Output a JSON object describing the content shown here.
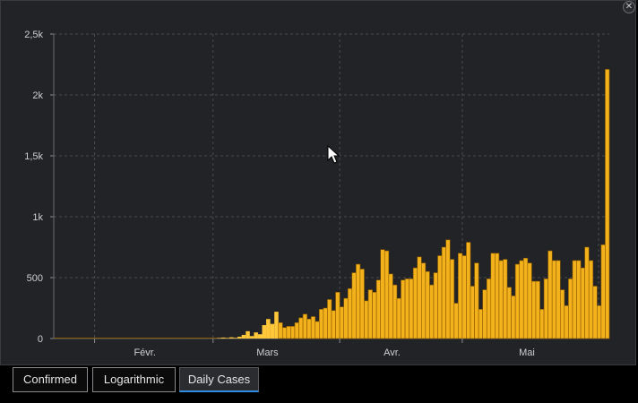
{
  "window": {
    "close_icon": "close-icon",
    "close_glyph": "✕"
  },
  "chart_data": {
    "type": "bar",
    "title": "",
    "xlabel": "",
    "ylabel": "",
    "ylim": [
      0,
      2500
    ],
    "yticks": [
      {
        "value": 0,
        "label": "0"
      },
      {
        "value": 500,
        "label": "500"
      },
      {
        "value": 1000,
        "label": "1k"
      },
      {
        "value": 1500,
        "label": "1,5k"
      },
      {
        "value": 2000,
        "label": "2k"
      },
      {
        "value": 2500,
        "label": "2,5k"
      }
    ],
    "xticks": [
      {
        "date": "2020-02-01",
        "label": "Févr."
      },
      {
        "date": "2020-03-01",
        "label": "Mars"
      },
      {
        "date": "2020-04-01",
        "label": "Avr."
      },
      {
        "date": "2020-05-01",
        "label": "Mai"
      }
    ],
    "x_start": "2020-01-22",
    "grid": true,
    "colors": {
      "bar": "#f3b21b",
      "bar_edge": "#8a5a00",
      "highlight_bar": "#ffc83a",
      "grid": "#4a4b4f",
      "axis_text": "#cfcfcf"
    },
    "highlight_range": [
      "2020-02-26",
      "2020-03-16"
    ],
    "values": [
      0,
      0,
      0,
      0,
      0,
      0,
      0,
      0,
      0,
      0,
      0,
      0,
      0,
      0,
      0,
      0,
      0,
      0,
      0,
      0,
      0,
      0,
      0,
      0,
      0,
      0,
      0,
      0,
      0,
      0,
      0,
      0,
      0,
      0,
      0,
      0,
      0,
      0,
      0,
      0,
      5,
      8,
      5,
      10,
      6,
      15,
      30,
      60,
      20,
      50,
      35,
      110,
      160,
      120,
      220,
      130,
      90,
      100,
      100,
      130,
      170,
      200,
      160,
      180,
      140,
      240,
      250,
      320,
      230,
      380,
      260,
      330,
      410,
      540,
      610,
      570,
      310,
      400,
      380,
      480,
      730,
      720,
      530,
      440,
      330,
      480,
      490,
      490,
      580,
      670,
      620,
      550,
      440,
      540,
      680,
      750,
      810,
      650,
      290,
      700,
      680,
      790,
      430,
      620,
      240,
      400,
      490,
      700,
      700,
      640,
      650,
      420,
      350,
      610,
      640,
      660,
      620,
      470,
      470,
      240,
      490,
      720,
      640,
      640,
      400,
      270,
      490,
      640,
      640,
      580,
      750,
      640,
      430,
      270,
      770,
      2210
    ]
  },
  "tabs": [
    {
      "label": "Confirmed"
    },
    {
      "label": "Logarithmic"
    },
    {
      "label": "Daily Cases"
    }
  ],
  "cursor_icon": "arrow-pointer-icon"
}
